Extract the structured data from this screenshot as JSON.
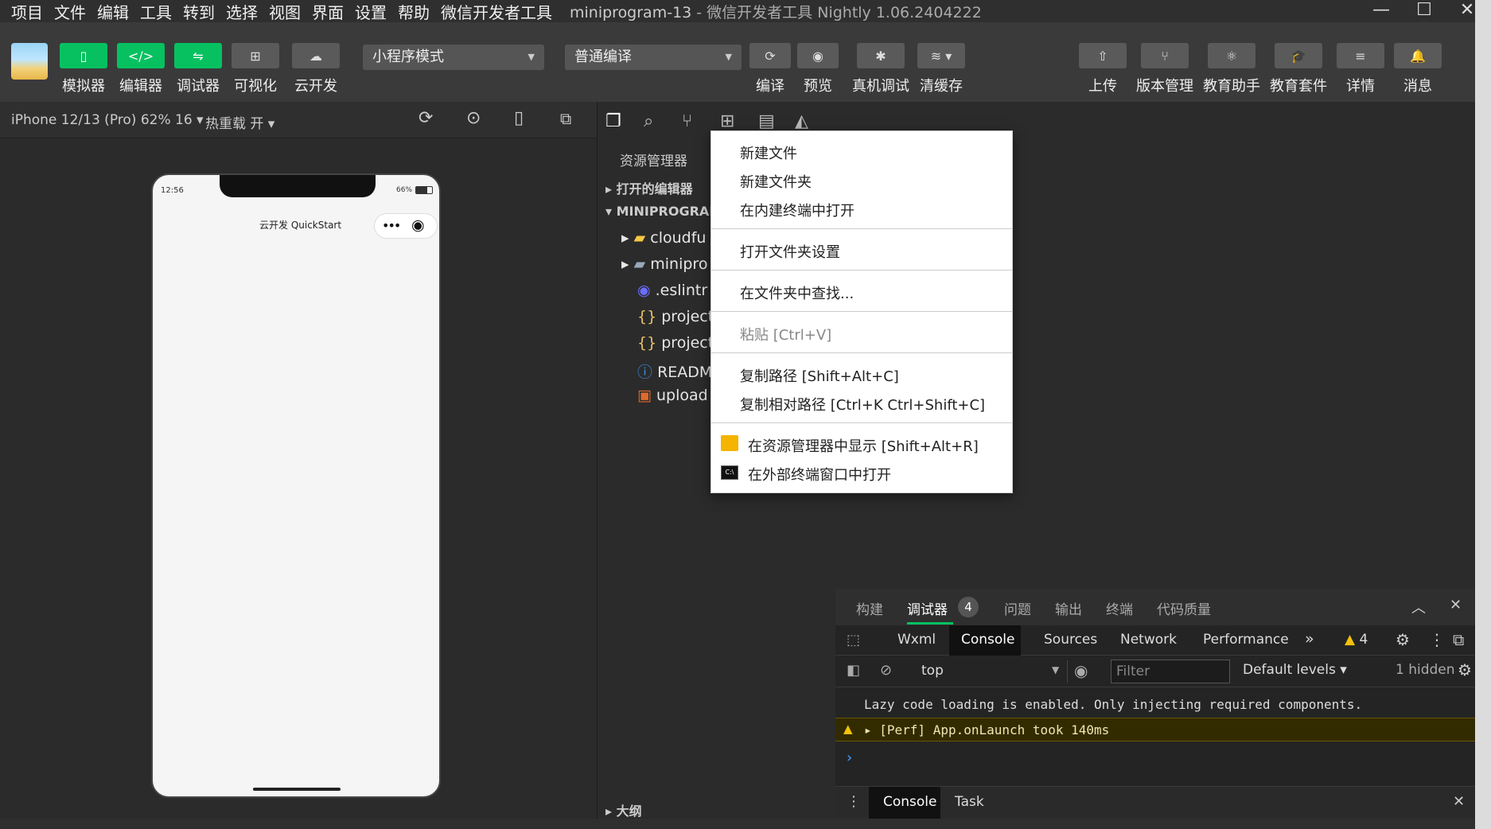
{
  "menubar": {
    "items": [
      "项目",
      "文件",
      "编辑",
      "工具",
      "转到",
      "选择",
      "视图",
      "界面",
      "设置",
      "帮助",
      "微信开发者工具"
    ],
    "title_project": "miniprogram-13",
    "title_rest": " - 微信开发者工具 Nightly 1.06.2404222"
  },
  "toolbar": {
    "left_buttons": [
      "模拟器",
      "编辑器",
      "调试器",
      "可视化",
      "云开发"
    ],
    "mode_select": "小程序模式",
    "compile_select": "普通编译",
    "mid_buttons": [
      "编译",
      "预览",
      "真机调试",
      "清缓存"
    ],
    "right_buttons": [
      "上传",
      "版本管理",
      "教育助手",
      "教育套件",
      "详情",
      "消息"
    ]
  },
  "simulator": {
    "device": "iPhone 12/13 (Pro) 62% 16",
    "hot_reload": "热重载 开",
    "status_time": "12:56",
    "status_battery": "66%",
    "nav_title": "云开发 QuickStart"
  },
  "explorer": {
    "header": "资源管理器",
    "open_editors": "打开的编辑器",
    "project_root": "MINIPROGRAM",
    "items": [
      "cloudfu",
      "minipro",
      ".eslintr",
      "project",
      "project",
      "READM",
      "upload"
    ],
    "outline": "大纲"
  },
  "context_menu": {
    "new_file": "新建文件",
    "new_folder": "新建文件夹",
    "open_in_terminal": "在内建终端中打开",
    "folder_settings": "打开文件夹设置",
    "find_in_folder": "在文件夹中查找...",
    "paste": "粘贴  [Ctrl+V]",
    "copy_path": "复制路径  [Shift+Alt+C]",
    "copy_relative_path": "复制相对路径  [Ctrl+K Ctrl+Shift+C]",
    "reveal_in_explorer": "在资源管理器中显示  [Shift+Alt+R]",
    "open_external_terminal": "在外部终端窗口中打开"
  },
  "debug_panel": {
    "tabs": [
      "构建",
      "调试器",
      "问题",
      "输出",
      "终端",
      "代码质量"
    ],
    "debugger_badge": "4",
    "devtools_tabs": [
      "Wxml",
      "Console",
      "Sources",
      "Network",
      "Performance"
    ],
    "more": "»",
    "warn_count": "4",
    "context": "top",
    "filter_placeholder": "Filter",
    "levels": "Default levels",
    "hidden": "1 hidden",
    "log_line": "Lazy code loading is enabled. Only injecting required components.",
    "warn_line": "[Perf] App.onLaunch took 140ms",
    "prompt": "›",
    "drawer_tabs": [
      "Console",
      "Task"
    ]
  },
  "colors": {
    "accent_green": "#07c160",
    "warning_bg": "#332b00"
  }
}
